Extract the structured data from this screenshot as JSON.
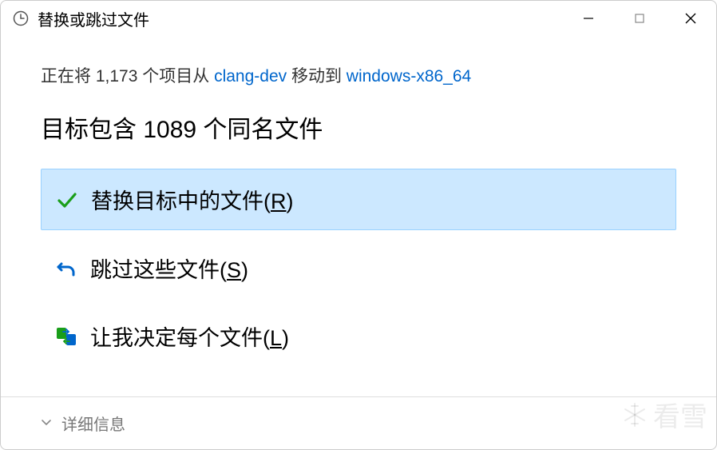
{
  "titlebar": {
    "title": "替换或跳过文件"
  },
  "move": {
    "prefix": "正在将 1,173 个项目从 ",
    "source": "clang-dev",
    "middle": " 移动到 ",
    "dest": "windows-x86_64"
  },
  "heading": "目标包含 1089 个同名文件",
  "options": {
    "replace": {
      "label": "替换目标中的文件(",
      "hotkey": "R",
      "suffix": ")"
    },
    "skip": {
      "label": "跳过这些文件(",
      "hotkey": "S",
      "suffix": ")"
    },
    "decide": {
      "label": "让我决定每个文件(",
      "hotkey": "L",
      "suffix": ")"
    }
  },
  "footer": {
    "details": "详细信息"
  },
  "watermark": "看雪"
}
